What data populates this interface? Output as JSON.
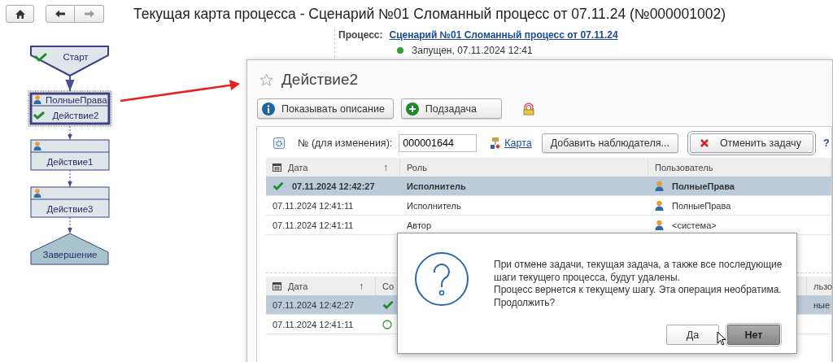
{
  "toolbar": {
    "title": "Текущая карта процесса - Сценарий №01 Сломанный процесс от 07.11.24 (№000001002)"
  },
  "process": {
    "label": "Процесс:",
    "link": "Сценарий №01 Сломанный процесс от 07.11.24",
    "status": "Запущен, 07.11.2024 12:41"
  },
  "flow": [
    {
      "kind": "start",
      "label": "Старт",
      "done": true,
      "selected": false
    },
    {
      "kind": "action",
      "user": "ПолныеПрава",
      "label": "Действие2",
      "done": true,
      "selected": true
    },
    {
      "kind": "action",
      "label": "Действие1",
      "done": false,
      "selected": false
    },
    {
      "kind": "action",
      "label": "Действие3",
      "done": false,
      "selected": false
    },
    {
      "kind": "end",
      "label": "Завершение",
      "done": false,
      "selected": false
    }
  ],
  "window": {
    "title": "Действие2",
    "buttons": [
      {
        "kind": "info",
        "label": "Показывать описание"
      },
      {
        "kind": "add",
        "label": "Подзадача"
      }
    ],
    "field_label": "№ (для изменения):",
    "field_value": "000001644",
    "map_link": "Карта",
    "add_observer": "Добавить наблюдателя...",
    "cancel_task": "Отменить задачу",
    "help": "?"
  },
  "table": {
    "columns": [
      {
        "label": "Дата",
        "sort_icon": "↑"
      },
      {
        "label": "Роль"
      },
      {
        "label": "Пользователь"
      }
    ],
    "rows": [
      {
        "date": "07.11.2024 12:42:27",
        "role": "Исполнитель",
        "user": "ПолныеПрава",
        "done": true,
        "selected": true
      },
      {
        "date": "07.11.2024 12:41:11",
        "role": "Исполнитель",
        "user": "ПолныеПрава",
        "done": false,
        "selected": false
      },
      {
        "date": "07.11.2024 12:41:11",
        "role": "Автор",
        "user": "<система>",
        "done": false,
        "selected": false
      }
    ]
  },
  "table2": {
    "columns": [
      {
        "label": "Дата",
        "sort_icon": "↑"
      },
      {
        "label": "Со"
      },
      {
        "label": "льзо"
      }
    ],
    "rows": [
      {
        "date": "07.11.2024 12:42:27",
        "done": true,
        "user": "ные",
        "selected": true
      },
      {
        "date": "07.11.2024 12:41:11",
        "done": false,
        "selected": false
      }
    ]
  },
  "dialog": {
    "message": "При отмене задачи, текущая задача, а также все последующие шаги текущего процесса, будут удалены.\nПроцесс вернется к текущему шагу. Эта операция необратима. Продолжить?",
    "buttons": [
      {
        "label": "Да",
        "default": false
      },
      {
        "label": "Нет",
        "default": true
      }
    ]
  }
}
